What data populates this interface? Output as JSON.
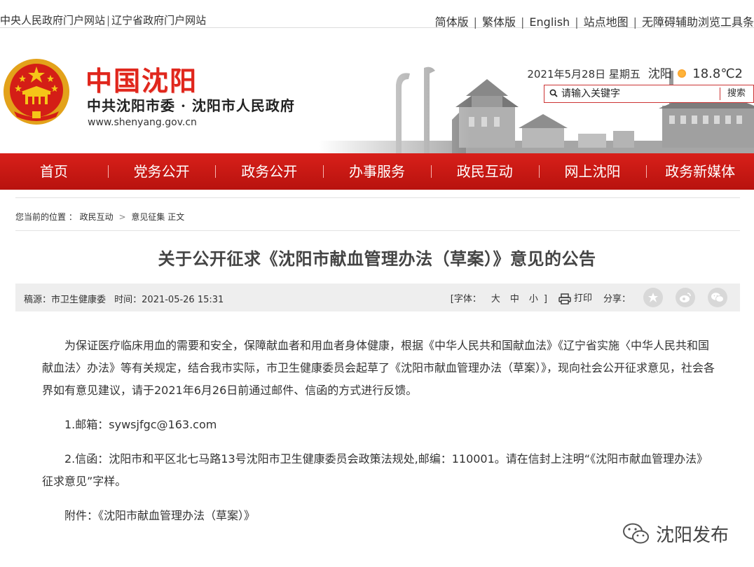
{
  "topbar": {
    "left_links": [
      "中央人民政府门户网站",
      "辽宁省政府门户网站"
    ],
    "right_links": [
      "简体版",
      "繁体版",
      "English",
      "站点地图",
      "无障碍辅助浏览工具条"
    ]
  },
  "header": {
    "logo_title": "中国沈阳",
    "logo_subtitle": "中共沈阳市委 · 沈阳市人民政府",
    "logo_url": "www.shenyang.gov.cn",
    "weather": {
      "date": "2021年5月28日 星期五",
      "city": "沈阳",
      "temp": "18.8℃2"
    },
    "search": {
      "placeholder": "请输入关键字",
      "button": "搜索"
    }
  },
  "nav": [
    "首页",
    "党务公开",
    "政务公开",
    "办事服务",
    "政民互动",
    "网上沈阳",
    "政务新媒体"
  ],
  "breadcrumb": {
    "prefix": "您当前的位置 ：",
    "items": [
      "政民互动",
      "意见征集"
    ],
    "current": "正文"
  },
  "article": {
    "title": "关于公开征求《沈阳市献血管理办法（草案）》意见的公告",
    "source": "稿源：市卫生健康委",
    "time": "时间：2021-05-26 15:31",
    "font_label": "[字体：",
    "font_sizes": [
      "大",
      "中",
      "小"
    ],
    "font_close": "]",
    "print": "打印",
    "share": "分享：",
    "paragraphs": [
      "为保证医疗临床用血的需要和安全，保障献血者和用血者身体健康，根据《中华人民共和国献血法》《辽宁省实施〈中华人民共和国献血法〉办法》等有关规定，结合我市实际，市卫生健康委员会起草了《沈阳市献血管理办法（草案）》，现向社会公开征求意见，社会各界如有意见建议，请于2021年6月26日前通过邮件、信函的方式进行反馈。",
      "1.邮箱：sywsjfgc@163.com",
      "2.信函：沈阳市和平区北七马路13号沈阳市卫生健康委员会政策法规处,邮编：110001。请在信封上注明“《沈阳市献血管理办法》征求意见”字样。",
      "附件：《沈阳市献血管理办法（草案）》"
    ]
  },
  "watermark": "沈阳发布",
  "colors": {
    "brand_red": "#d01f19",
    "nav_red": "#c8170f",
    "info_bg": "#eeeeee"
  }
}
